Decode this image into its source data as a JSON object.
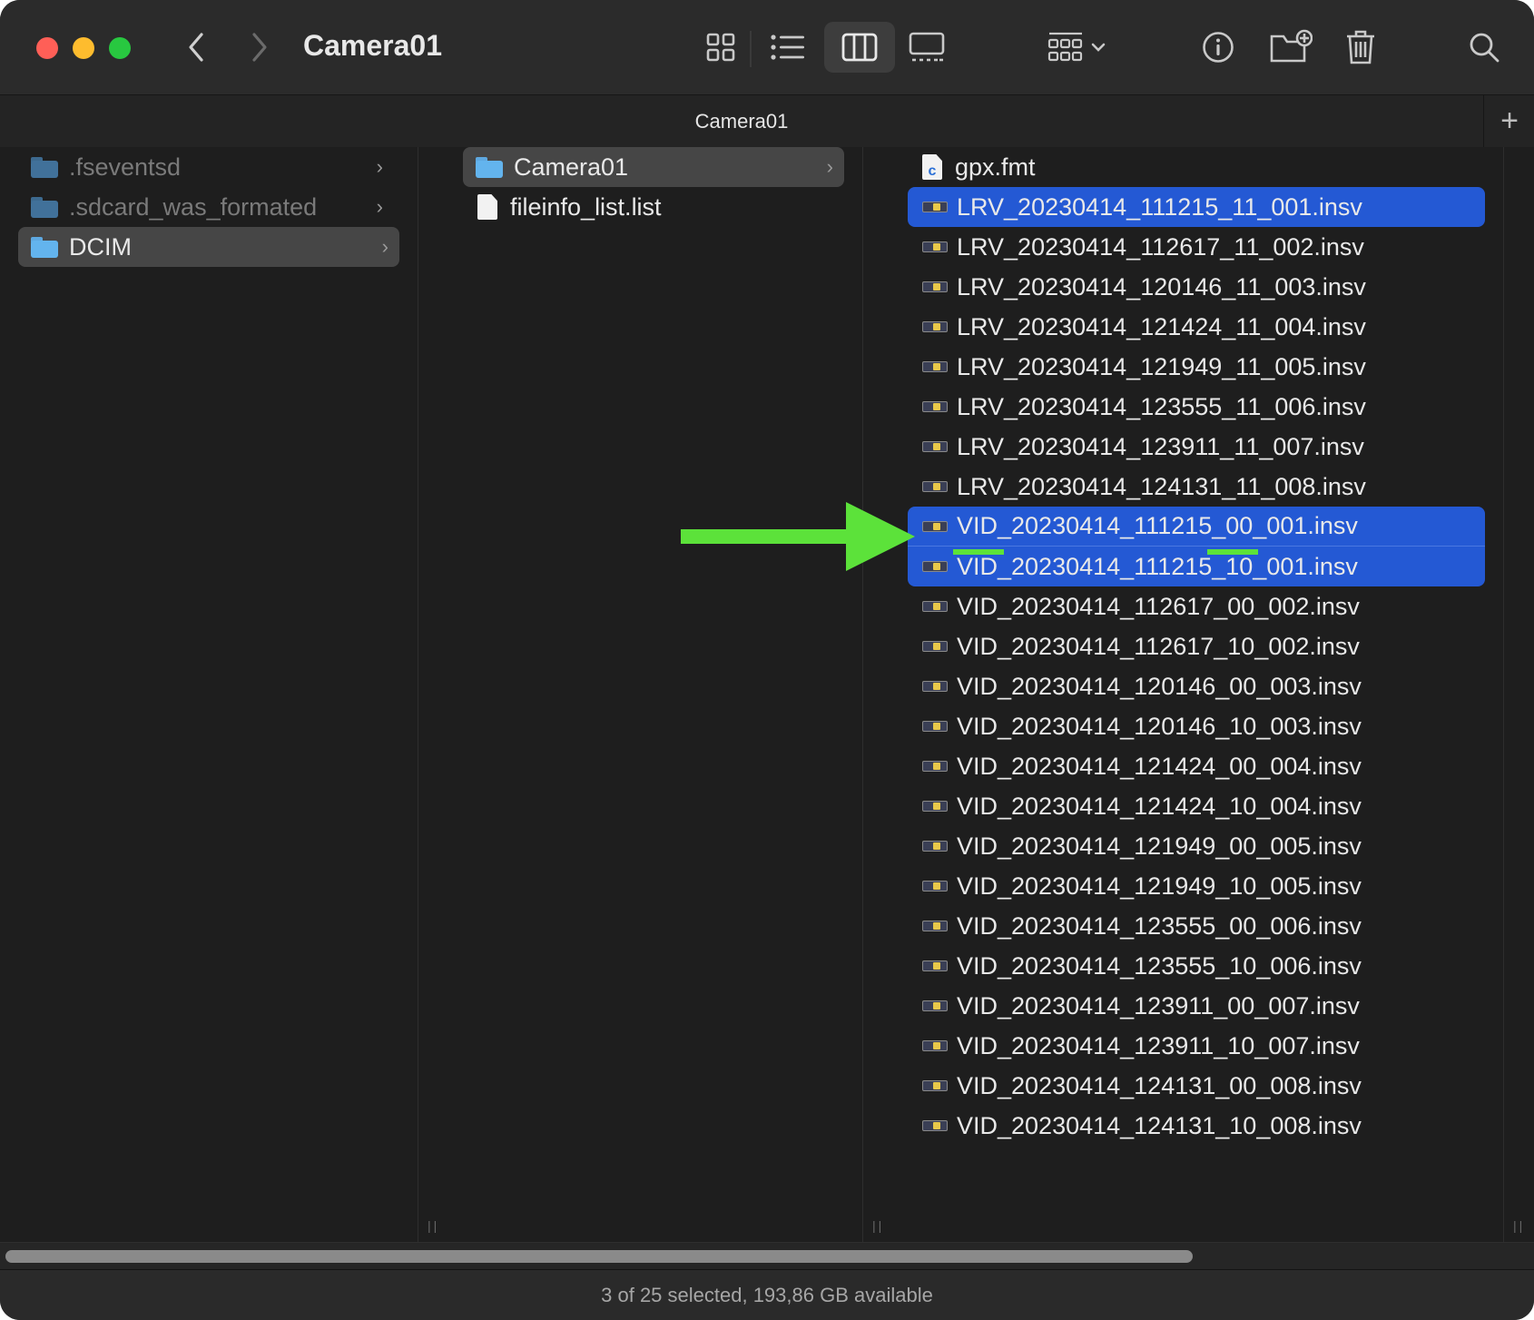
{
  "window": {
    "title": "Camera01",
    "tab_title": "Camera01",
    "tab_add_label": "+"
  },
  "toolbar": {
    "icons": [
      "back-icon",
      "forward-icon",
      "icon-view-icon",
      "list-view-icon",
      "column-view-icon",
      "gallery-view-icon",
      "group-icon",
      "info-icon",
      "new-folder-icon",
      "trash-icon",
      "search-icon"
    ],
    "active_view": "columns"
  },
  "column1": {
    "items": [
      {
        "label": ".fseventsd",
        "type": "folder",
        "hidden": true,
        "chevron": "›"
      },
      {
        "label": ".sdcard_was_formated",
        "type": "folder",
        "hidden": true,
        "chevron": "›"
      },
      {
        "label": "DCIM",
        "type": "folder",
        "selected": true,
        "chevron": "›"
      }
    ]
  },
  "column2": {
    "items": [
      {
        "label": "Camera01",
        "type": "folder",
        "selected": true,
        "chevron": "›"
      },
      {
        "label": "fileinfo_list.list",
        "type": "document"
      }
    ]
  },
  "column3": {
    "items": [
      {
        "label": "gpx.fmt",
        "type": "c-document"
      },
      {
        "label": "LRV_20230414_111215_11_001.insv",
        "type": "video",
        "selected": true
      },
      {
        "label": "LRV_20230414_112617_11_002.insv",
        "type": "video"
      },
      {
        "label": "LRV_20230414_120146_11_003.insv",
        "type": "video"
      },
      {
        "label": "LRV_20230414_121424_11_004.insv",
        "type": "video"
      },
      {
        "label": "LRV_20230414_121949_11_005.insv",
        "type": "video"
      },
      {
        "label": "LRV_20230414_123555_11_006.insv",
        "type": "video"
      },
      {
        "label": "LRV_20230414_123911_11_007.insv",
        "type": "video"
      },
      {
        "label": "LRV_20230414_124131_11_008.insv",
        "type": "video"
      },
      {
        "label": "VID_20230414_111215_00_001.insv",
        "type": "video",
        "selected": true
      },
      {
        "label": "VID_20230414_111215_10_001.insv",
        "type": "video",
        "selected": true
      },
      {
        "label": "VID_20230414_112617_00_002.insv",
        "type": "video"
      },
      {
        "label": "VID_20230414_112617_10_002.insv",
        "type": "video"
      },
      {
        "label": "VID_20230414_120146_00_003.insv",
        "type": "video"
      },
      {
        "label": "VID_20230414_120146_10_003.insv",
        "type": "video"
      },
      {
        "label": "VID_20230414_121424_00_004.insv",
        "type": "video"
      },
      {
        "label": "VID_20230414_121424_10_004.insv",
        "type": "video"
      },
      {
        "label": "VID_20230414_121949_00_005.insv",
        "type": "video"
      },
      {
        "label": "VID_20230414_121949_10_005.insv",
        "type": "video"
      },
      {
        "label": "VID_20230414_123555_00_006.insv",
        "type": "video"
      },
      {
        "label": "VID_20230414_123555_10_006.insv",
        "type": "video"
      },
      {
        "label": "VID_20230414_123911_00_007.insv",
        "type": "video"
      },
      {
        "label": "VID_20230414_123911_10_007.insv",
        "type": "video"
      },
      {
        "label": "VID_20230414_124131_00_008.insv",
        "type": "video"
      },
      {
        "label": "VID_20230414_124131_10_008.insv",
        "type": "video"
      }
    ]
  },
  "status_bar": {
    "text": "3 of 25 selected, 193,86 GB available"
  },
  "colors": {
    "selection_blue": "#2459d4",
    "selection_gray": "#464646",
    "annotation_green": "#5ce23a"
  }
}
